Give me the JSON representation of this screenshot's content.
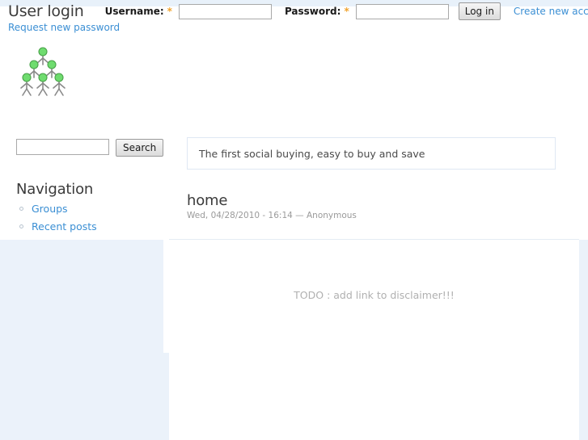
{
  "theme": {
    "accent_blue": "#3b8fd4",
    "panel_blue": "#ebf2fa",
    "band_blue": "#e8f1fa",
    "required_orange": "#f0a32e",
    "logo_green": "#6fdc6f",
    "logo_gray": "#8a8a8a"
  },
  "header": {
    "title": "User login",
    "username_label": "Username:",
    "username_required": "*",
    "username_value": "",
    "password_label": "Password:",
    "password_required": "*",
    "password_value": "",
    "login_button": "Log in",
    "create_account_link": "Create new account",
    "request_password_link": "Request new password"
  },
  "logo": {
    "name": "social-network-people-logo",
    "alt": "Social buying group logo"
  },
  "sidebar": {
    "search": {
      "value": "",
      "placeholder": "",
      "button_label": "Search"
    },
    "navigation": {
      "title": "Navigation",
      "items": [
        {
          "label": "Groups"
        },
        {
          "label": "Recent posts"
        }
      ]
    }
  },
  "main": {
    "mission": "The first social buying, easy to buy and save",
    "node": {
      "title": "home",
      "submitted": "Wed, 04/28/2010 - 16:14 — Anonymous"
    }
  },
  "footer": {
    "message": "TODO : add link to disclaimer!!!"
  }
}
